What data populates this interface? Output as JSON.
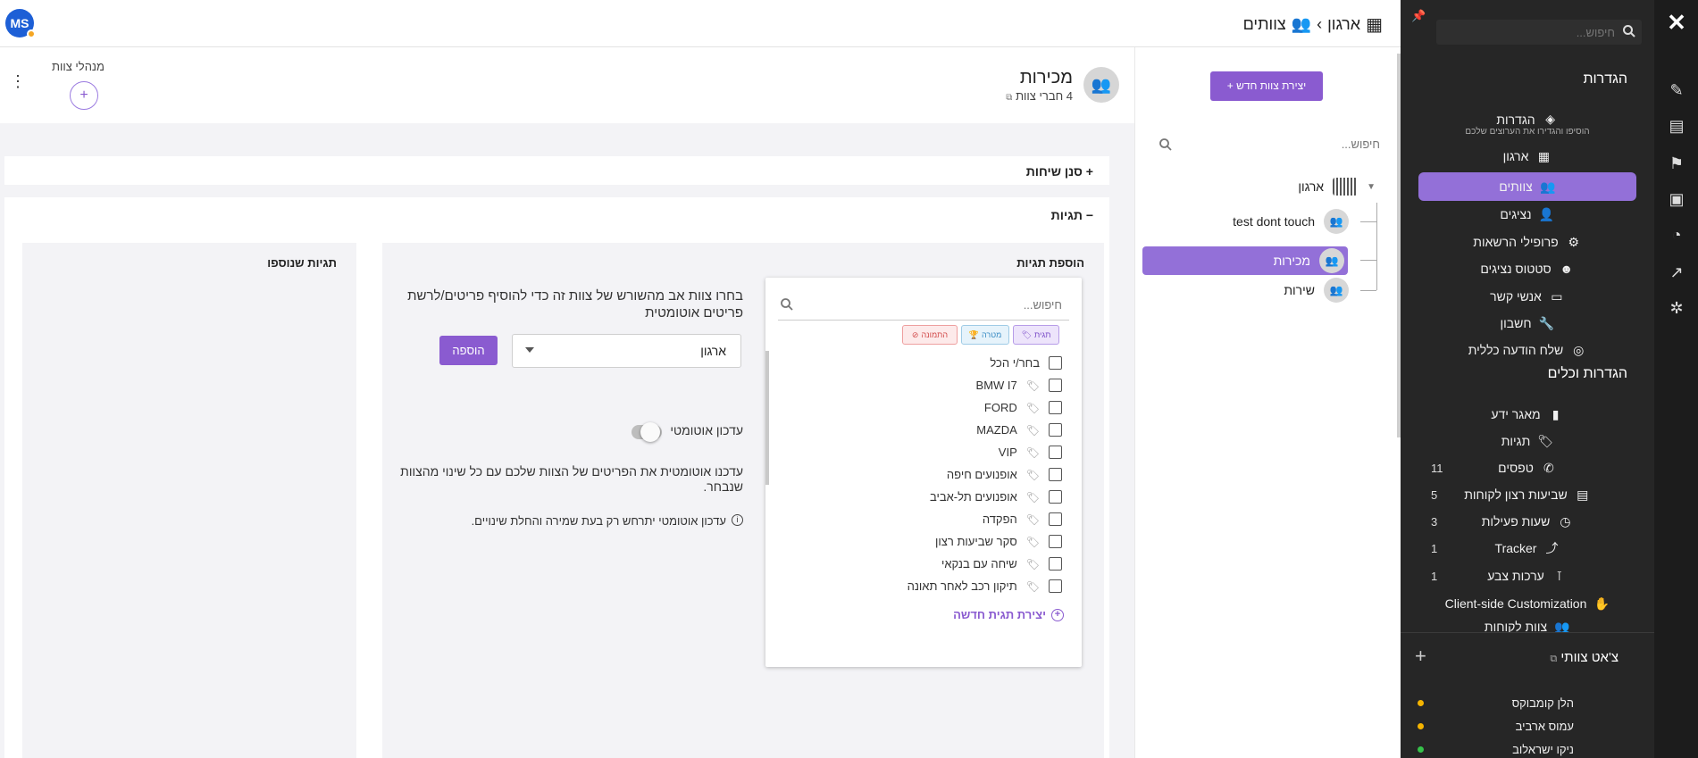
{
  "header": {
    "breadcrumb": {
      "root": "ארגון",
      "separator": "›",
      "current": "צוותים"
    },
    "avatar_initials": "MS"
  },
  "sidebar": {
    "search_placeholder": "חיפוש...",
    "settings_title": "הגדרות",
    "items": [
      {
        "label": "הגדרות",
        "hint": "הוסיפו והגדירו את הערוצים שלכם",
        "icon": "layers-icon"
      },
      {
        "label": "ארגון",
        "icon": "building-icon"
      },
      {
        "label": "צוותים",
        "icon": "teams-icon",
        "active": true
      },
      {
        "label": "נציגים",
        "icon": "agents-icon"
      },
      {
        "label": "פרופילי הרשאות",
        "icon": "permissions-icon"
      },
      {
        "label": "סטטוס נציגים",
        "icon": "agent-status-icon"
      },
      {
        "label": "אנשי קשר",
        "icon": "contacts-icon"
      },
      {
        "label": "חשבון",
        "icon": "wrench-icon"
      },
      {
        "label": "שלח הודעה כללית",
        "icon": "broadcast-icon"
      }
    ],
    "tools_title": "הגדרות וכלים",
    "tools": [
      {
        "label": "מאגר ידע",
        "count": "",
        "icon": "book-icon"
      },
      {
        "label": "תגיות",
        "count": "",
        "icon": "tags-icon"
      },
      {
        "label": "טפסים",
        "count": "11",
        "icon": "forms-icon"
      },
      {
        "label": "שביעות רצון לקוחות",
        "count": "5",
        "icon": "survey-icon"
      },
      {
        "label": "שעות פעילות",
        "count": "3",
        "icon": "clock-icon"
      },
      {
        "label": "Tracker",
        "count": "1",
        "icon": "tracker-icon"
      },
      {
        "label": "ערכות צבע",
        "count": "1",
        "icon": "paint-icon"
      },
      {
        "label": "Client-side Customization",
        "count": "",
        "icon": "puzzle-icon"
      },
      {
        "label": "צוות לקוחות",
        "count": "",
        "icon": "team-icon"
      }
    ],
    "chat_title": "צ'אט צוותי",
    "chat_users": [
      {
        "name": "הלן קומבוקס",
        "status_color": "#f5b400"
      },
      {
        "name": "עמוס ארביב",
        "status_color": "#f5b400"
      },
      {
        "name": "ניקו ישראלוב",
        "status_color": "#36c24a"
      }
    ]
  },
  "tree": {
    "create_button": "+ יצירת צוות חדש",
    "search_placeholder": "חיפוש...",
    "root": "ארגון",
    "teams": [
      {
        "name": "test dont touch",
        "active": false
      },
      {
        "name": "מכירות",
        "active": true
      },
      {
        "name": "שירות",
        "active": false
      }
    ]
  },
  "team": {
    "name": "מכירות",
    "members": "4 חברי צוות",
    "managers_title": "מנהלי צוות"
  },
  "sections": {
    "conversation_filter": "+ סנן שיחות",
    "tags": "− תגיות"
  },
  "tags_panel": {
    "add_title": "הוספת תגיות",
    "added_title": "תגיות שנוספו",
    "search_placeholder": "חיפוש...",
    "chips": {
      "tag": "תגית",
      "award": "מטרה",
      "block": "התמונה"
    },
    "select_all": "בחר/י הכל",
    "options": [
      "BMW I7",
      "FORD",
      "MAZDA",
      "VIP",
      "אופנועים חיפה",
      "אופנועים תל-אביב",
      "הפקדה",
      "סקר שביעות רצון",
      "שיחה עם בנקאי",
      "תיקון רכב לאחר תאונה"
    ],
    "create_new": "יצירת תגית חדשה",
    "parent_text": "בחרו צוות אב מהשורש של צוות זה כדי להוסיף פריטים/לרשת פריטים אוטומטית",
    "parent_value": "ארגון",
    "add_button": "הוספה",
    "auto_update_label": "עדכון אוטומטי",
    "auto_update_on": false,
    "auto_update_desc": "עדכנו אוטומטית את הפריטים של הצוות שלכם עם כל שינוי מהצוות שנבחר.",
    "auto_update_note": "עדכון אוטומטי יתרחש רק בעת שמירה והחלת שינויים."
  },
  "colors": {
    "accent": "#8a5bd0",
    "sidebar_bg": "#262626",
    "rail_bg": "#1c1c1c"
  }
}
